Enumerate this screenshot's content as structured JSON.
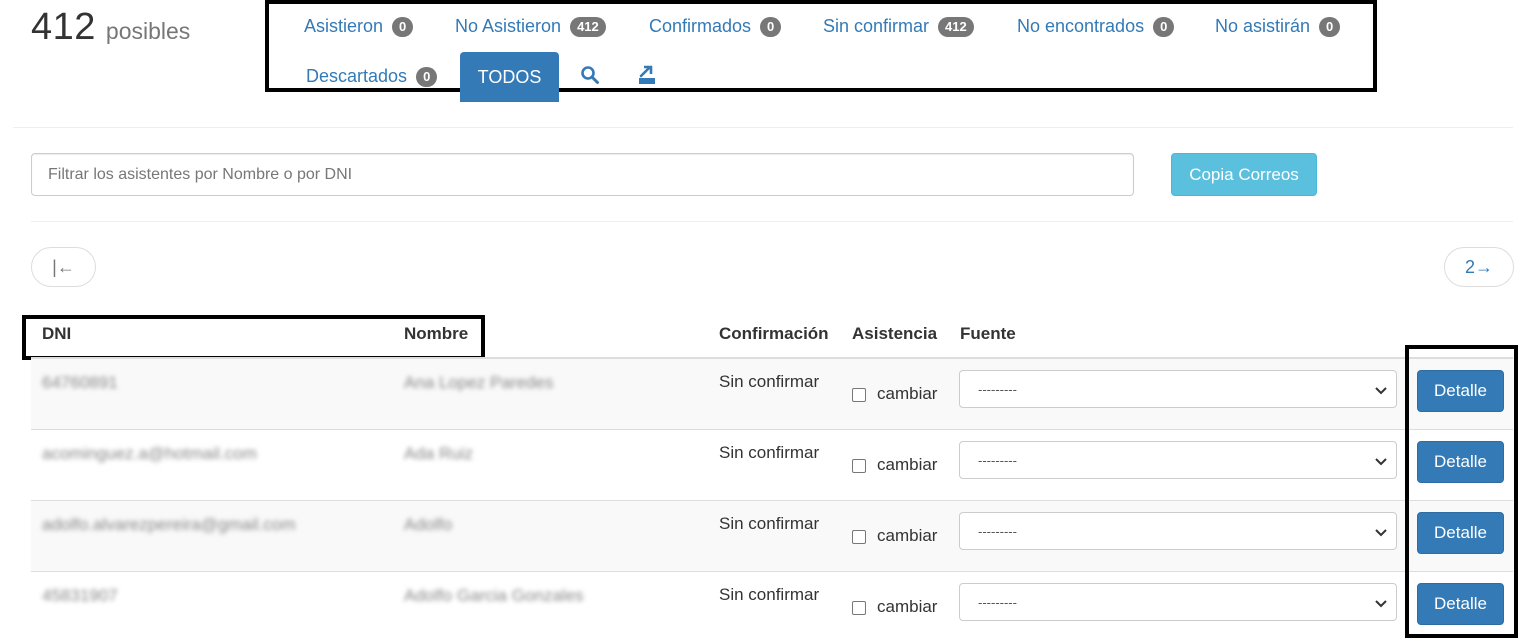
{
  "header": {
    "count": "412",
    "count_label": "posibles"
  },
  "tabs": [
    {
      "label": "Asistieron",
      "badge": "0"
    },
    {
      "label": "No Asistieron",
      "badge": "412"
    },
    {
      "label": "Confirmados",
      "badge": "0"
    },
    {
      "label": "Sin confirmar",
      "badge": "412"
    },
    {
      "label": "No encontrados",
      "badge": "0"
    },
    {
      "label": "No asistirán",
      "badge": "0"
    },
    {
      "label": "Descartados",
      "badge": "0"
    },
    {
      "label": "TODOS"
    }
  ],
  "icons": {
    "search": "search-icon",
    "export": "export-icon"
  },
  "search": {
    "placeholder": "Filtrar los asistentes por Nombre o por DNI",
    "value": ""
  },
  "copy_button": "Copia Correos",
  "pagination": {
    "first": "|←",
    "next": "2→"
  },
  "table": {
    "headers": {
      "dni": "DNI",
      "nombre": "Nombre",
      "confirmacion": "Confirmación",
      "asistencia": "Asistencia",
      "fuente": "Fuente"
    },
    "rows": [
      {
        "dni": "64760891",
        "nombre": "Ana Lopez Paredes",
        "confirmacion": "Sin confirmar",
        "asistencia": "cambiar",
        "fuente": "---------",
        "action": "Detalle"
      },
      {
        "dni": "acominguez.a@hotmail.com",
        "nombre": "Ada Ruiz",
        "confirmacion": "Sin confirmar",
        "asistencia": "cambiar",
        "fuente": "---------",
        "action": "Detalle"
      },
      {
        "dni": "adolfo.alvarezpereira@gmail.com",
        "nombre": "Adolfo",
        "confirmacion": "Sin confirmar",
        "asistencia": "cambiar",
        "fuente": "---------",
        "action": "Detalle"
      },
      {
        "dni": "45831907",
        "nombre": "Adolfo Garcia Gonzales",
        "confirmacion": "Sin confirmar",
        "asistencia": "cambiar",
        "fuente": "---------",
        "action": "Detalle"
      }
    ]
  },
  "colors": {
    "link": "#337ab7",
    "primary": "#337ab7",
    "info": "#5bc0de",
    "badge": "#777777"
  }
}
